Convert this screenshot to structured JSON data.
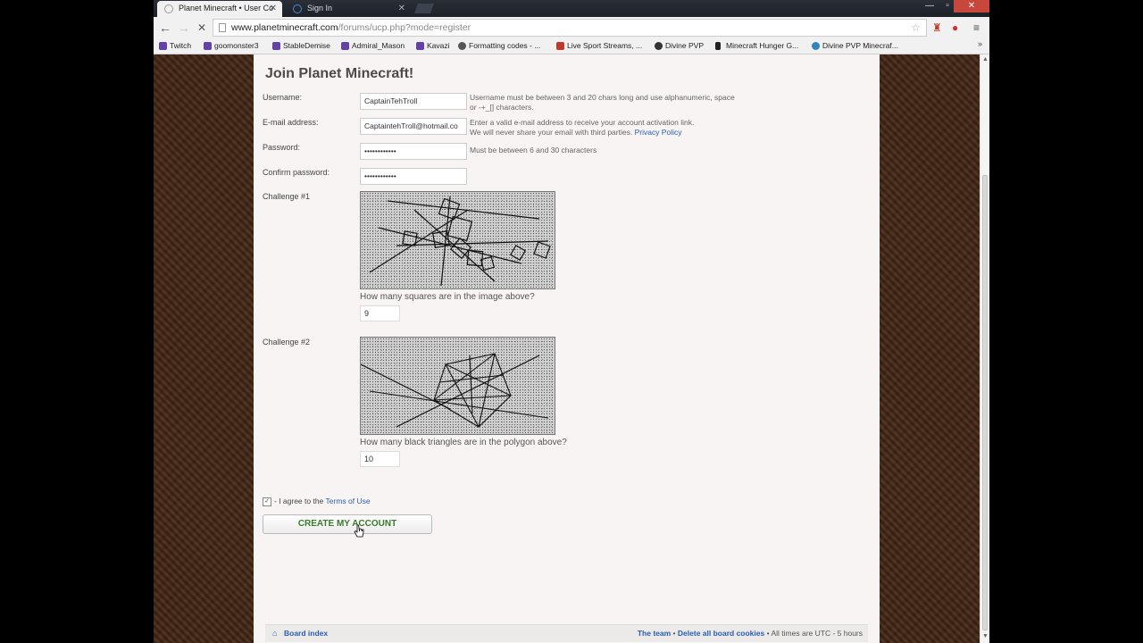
{
  "browser": {
    "tabs": [
      {
        "label": "Planet Minecraft • User Co",
        "active": true
      },
      {
        "label": "Sign In",
        "active": false
      }
    ],
    "window_controls": {
      "minimize": "—",
      "maximize": "▫",
      "close": "✕"
    },
    "nav": {
      "back": "←",
      "forward": "→",
      "reload": "✕"
    },
    "address": {
      "host": "www.planetminecraft.com",
      "path": "/forums/ucp.php?mode=register"
    },
    "bookmarks": [
      {
        "label": "Twitch",
        "icon": "twitch-icon",
        "color": "#6441a5"
      },
      {
        "label": "goomonster3",
        "icon": "twitch-icon",
        "color": "#6441a5"
      },
      {
        "label": "StableDemise",
        "icon": "twitch-icon",
        "color": "#6441a5"
      },
      {
        "label": "Admiral_Mason",
        "icon": "twitch-icon",
        "color": "#6441a5"
      },
      {
        "label": "Kavazi",
        "icon": "twitch-icon",
        "color": "#6441a5"
      },
      {
        "label": "Formatting codes - ...",
        "icon": "gear-icon",
        "color": "#555555"
      },
      {
        "label": "Live Sport Streams, ...",
        "icon": "tv-icon",
        "color": "#c0392b"
      },
      {
        "label": "Divine PVP",
        "icon": "circle-icon",
        "color": "#333333"
      },
      {
        "label": "Minecraft Hunger G...",
        "icon": "figure-icon",
        "color": "#222222"
      },
      {
        "label": "Divine PVP Minecraf...",
        "icon": "globe-icon",
        "color": "#2e86c1"
      }
    ],
    "bookmarks_more": "»"
  },
  "page": {
    "title": "Join Planet Minecraft!",
    "fields": {
      "username": {
        "label": "Username:",
        "value": "CaptainTehTroll",
        "hint": "Username must be between 3 and 20 chars long and use alphanumeric, space or -+_[] characters."
      },
      "email": {
        "label": "E-mail address:",
        "value": "CaptaintehTroll@hotmail.co",
        "hint_line1": "Enter a valid e-mail address to receive your account activation link.",
        "hint_line2": "We will never share your email with third parties.",
        "privacy_link": "Privacy Policy"
      },
      "password": {
        "label": "Password:",
        "value": "••••••••••••",
        "hint": "Must be between 6 and 30 characters"
      },
      "confirm": {
        "label": "Confirm password:",
        "value": "••••••••••••"
      }
    },
    "challenge1": {
      "label": "Challenge #1",
      "question": "How many squares are in the image above?",
      "answer": "9"
    },
    "challenge2": {
      "label": "Challenge #2",
      "question": "How many black triangles are in the polygon above?",
      "answer": "10"
    },
    "agree": {
      "checkbox": "✓",
      "text": "- I agree to the",
      "link": "Terms of Use",
      "checked": true
    },
    "submit": "CREATE MY ACCOUNT",
    "footer": {
      "board_index": "Board index",
      "team": "The team",
      "sep": "•",
      "delete_cookies": "Delete all board cookies",
      "times": "All times are UTC - 5 hours"
    }
  }
}
